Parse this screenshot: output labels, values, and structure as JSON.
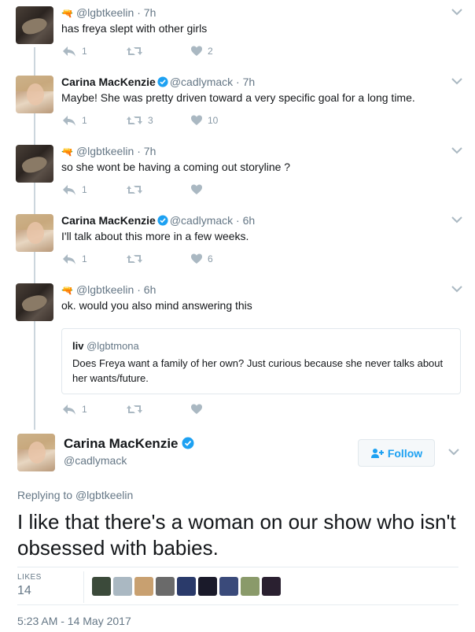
{
  "colors": {
    "accent": "#1da1f2",
    "muted": "#657786",
    "icon": "#8899a6",
    "line": "#ccd6dd"
  },
  "thread": [
    {
      "kind": "user",
      "display_name": "",
      "handle": "@lgbtkeelin",
      "time": "7h",
      "text": "has freya slept with other girls",
      "replies": "1",
      "retweets": "",
      "likes": "2"
    },
    {
      "kind": "carina",
      "display_name": "Carina MacKenzie",
      "handle": "@cadlymack",
      "time": "7h",
      "text": "Maybe! She was pretty driven toward a very specific goal for a long time.",
      "replies": "1",
      "retweets": "3",
      "likes": "10"
    },
    {
      "kind": "user",
      "display_name": "",
      "handle": "@lgbtkeelin",
      "time": "7h",
      "text": "so she wont be having a coming out storyline ?",
      "replies": "1",
      "retweets": "",
      "likes": ""
    },
    {
      "kind": "carina",
      "display_name": "Carina MacKenzie",
      "handle": "@cadlymack",
      "time": "6h",
      "text": "I'll talk about this more in a few weeks.",
      "replies": "1",
      "retweets": "",
      "likes": "6"
    },
    {
      "kind": "user",
      "display_name": "",
      "handle": "@lgbtkeelin",
      "time": "6h",
      "text": "ok. would you also mind answering this",
      "replies": "1",
      "retweets": "",
      "likes": ""
    }
  ],
  "quote": {
    "name": "liv",
    "handle": "@lgbtmona",
    "text": "Does Freya want a family of her own? Just curious because she never talks about her wants/future."
  },
  "main": {
    "display_name": "Carina MacKenzie",
    "handle": "@cadlymack",
    "follow_label": "Follow",
    "replying_prefix": "Replying to",
    "replying_to": "@lgbtkeelin",
    "text": "I like that there's a woman on our show who isn't obsessed with babies.",
    "likes_label": "LIKES",
    "likes_count": "14",
    "timestamp": "5:23 AM - 14 May 2017"
  },
  "likers": [
    {
      "name": "liker-1",
      "color": "#3b4a3a"
    },
    {
      "name": "liker-2",
      "color": "#aab8c2"
    },
    {
      "name": "liker-3",
      "color": "#c8a070"
    },
    {
      "name": "liker-4",
      "color": "#6a6a6a"
    },
    {
      "name": "liker-5",
      "color": "#2a3a6a"
    },
    {
      "name": "liker-6",
      "color": "#1a1a2a"
    },
    {
      "name": "liker-7",
      "color": "#3a4a7a"
    },
    {
      "name": "liker-8",
      "color": "#8a9a6a"
    },
    {
      "name": "liker-9",
      "color": "#2a2030"
    }
  ]
}
